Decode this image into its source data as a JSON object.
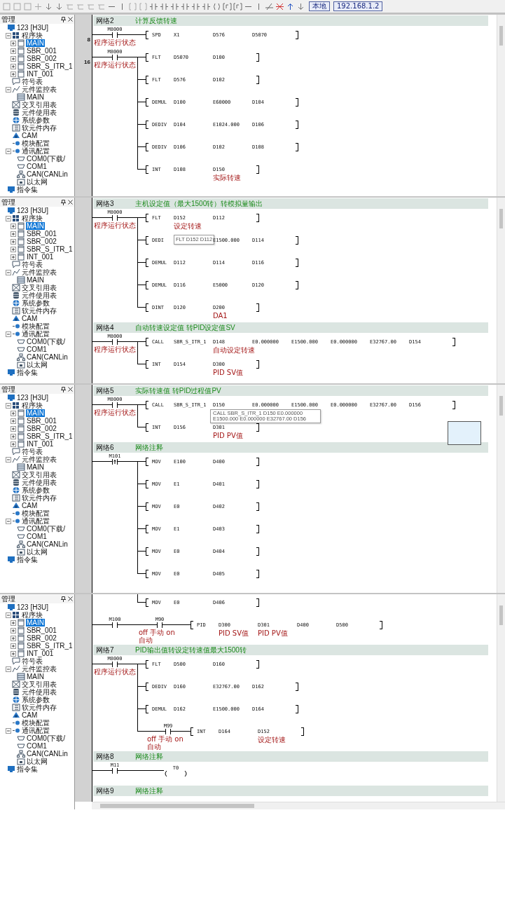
{
  "toolbar": {
    "buttons": [
      {
        "label": "本地"
      },
      {
        "label": "192.168.1.2"
      }
    ]
  },
  "panels": [
    {
      "sidebar": {
        "title": "管理",
        "tree": [
          {
            "label": "123 [H3U]",
            "kind": "plc",
            "selected": false,
            "children": [
              {
                "label": "程序块",
                "kind": "blocks",
                "selected": false,
                "expanded": true,
                "children": [
                  {
                    "label": "MAIN",
                    "kind": "program",
                    "selected": true,
                    "expanded": false
                  },
                  {
                    "label": "SBR_001",
                    "kind": "program",
                    "selected": false,
                    "expanded": false
                  },
                  {
                    "label": "SBR_002",
                    "kind": "program",
                    "selected": false,
                    "expanded": false
                  },
                  {
                    "label": "SBR_S_ITR_1",
                    "kind": "program",
                    "selected": false,
                    "expanded": false
                  },
                  {
                    "label": "INT_001",
                    "kind": "program",
                    "selected": false,
                    "expanded": false
                  }
                ]
              },
              {
                "label": "符号表",
                "kind": "symbols",
                "selected": false
              },
              {
                "label": "元件监控表",
                "kind": "monitor",
                "selected": false,
                "expanded": true,
                "children": [
                  {
                    "label": "MAIN",
                    "kind": "table",
                    "selected": false
                  }
                ]
              },
              {
                "label": "交叉引用表",
                "kind": "crossref",
                "selected": false
              },
              {
                "label": "元件使用表",
                "kind": "usage",
                "selected": false
              },
              {
                "label": "系统参数",
                "kind": "params",
                "selected": false
              },
              {
                "label": "软元件内存",
                "kind": "memory",
                "selected": false
              },
              {
                "label": "CAM",
                "kind": "cam",
                "selected": false
              },
              {
                "label": "模块配置",
                "kind": "module",
                "selected": false
              },
              {
                "label": "通讯配置",
                "kind": "module",
                "selected": false,
                "expanded": true,
                "children": [
                  {
                    "label": "COM0(下载/",
                    "kind": "port",
                    "selected": false
                  },
                  {
                    "label": "COM1",
                    "kind": "port",
                    "selected": false
                  },
                  {
                    "label": "CAN(CANLin",
                    "kind": "network",
                    "selected": false
                  },
                  {
                    "label": "以太网",
                    "kind": "ethernet",
                    "selected": false
                  }
                ]
              }
            ]
          },
          {
            "label": "指令集",
            "kind": "plc",
            "selected": false
          }
        ]
      },
      "ladder": {
        "rows": [
          {
            "kind": "network",
            "label": "网络2",
            "comment": "计算反馈转速"
          },
          {
            "kind": "rung",
            "step": "8",
            "contacts": [
              {
                "kind": "normally_open",
                "device": "M8000",
                "comment": "程序运行状态"
              }
            ],
            "branches": [
              {
                "kind": "instruction",
                "instr": "SPD",
                "operands": [
                  {
                    "text": "X1"
                  },
                  {
                    "text": "D576"
                  },
                  {
                    "text": "D5070"
                  }
                ]
              }
            ]
          },
          {
            "kind": "rung",
            "step": "16",
            "contacts": [
              {
                "kind": "normally_open",
                "device": "M8000",
                "comment": "程序运行状态"
              }
            ],
            "branches": [
              {
                "kind": "instruction",
                "instr": "FLT",
                "operands": [
                  {
                    "text": "D5070"
                  },
                  {
                    "text": "D100"
                  }
                ]
              },
              {
                "kind": "instruction",
                "instr": "FLT",
                "operands": [
                  {
                    "text": "D576"
                  },
                  {
                    "text": "D102"
                  }
                ]
              },
              {
                "kind": "instruction",
                "instr": "DEMUL",
                "operands": [
                  {
                    "text": "D100"
                  },
                  {
                    "text": "E60000"
                  },
                  {
                    "text": "D104"
                  }
                ]
              },
              {
                "kind": "instruction",
                "instr": "DEDIV",
                "operands": [
                  {
                    "text": "D104"
                  },
                  {
                    "text": "E1024.000"
                  },
                  {
                    "text": "D106"
                  }
                ]
              },
              {
                "kind": "instruction",
                "instr": "DEDIV",
                "operands": [
                  {
                    "text": "D106"
                  },
                  {
                    "text": "D102"
                  },
                  {
                    "text": "D108"
                  }
                ]
              },
              {
                "kind": "instruction",
                "instr": "INT",
                "operands": [
                  {
                    "text": "D108"
                  },
                  {
                    "text": "D150",
                    "comment": "实际转速"
                  }
                ]
              }
            ]
          }
        ]
      }
    },
    {
      "sidebar": {
        "title": "管理",
        "tree": [
          {
            "label": "123 [H3U]",
            "kind": "plc",
            "selected": false,
            "children": [
              {
                "label": "程序块",
                "kind": "blocks",
                "selected": false,
                "expanded": true,
                "children": [
                  {
                    "label": "MAIN",
                    "kind": "program",
                    "selected": true,
                    "expanded": false
                  },
                  {
                    "label": "SBR_001",
                    "kind": "program",
                    "selected": false,
                    "expanded": false
                  },
                  {
                    "label": "SBR_002",
                    "kind": "program",
                    "selected": false,
                    "expanded": false
                  },
                  {
                    "label": "SBR_S_ITR_1",
                    "kind": "program",
                    "selected": false,
                    "expanded": false
                  },
                  {
                    "label": "INT_001",
                    "kind": "program",
                    "selected": false,
                    "expanded": false
                  }
                ]
              },
              {
                "label": "符号表",
                "kind": "symbols",
                "selected": false
              },
              {
                "label": "元件监控表",
                "kind": "monitor",
                "selected": false,
                "expanded": true,
                "children": [
                  {
                    "label": "MAIN",
                    "kind": "table",
                    "selected": false
                  }
                ]
              },
              {
                "label": "交叉引用表",
                "kind": "crossref",
                "selected": false
              },
              {
                "label": "元件使用表",
                "kind": "usage",
                "selected": false
              },
              {
                "label": "系统参数",
                "kind": "params",
                "selected": false
              },
              {
                "label": "软元件内存",
                "kind": "memory",
                "selected": false
              },
              {
                "label": "CAM",
                "kind": "cam",
                "selected": false
              },
              {
                "label": "模块配置",
                "kind": "module",
                "selected": false
              },
              {
                "label": "通讯配置",
                "kind": "module",
                "selected": false,
                "expanded": true,
                "children": [
                  {
                    "label": "COM0(下载/",
                    "kind": "port",
                    "selected": false
                  },
                  {
                    "label": "COM1",
                    "kind": "port",
                    "selected": false
                  },
                  {
                    "label": "CAN(CANLin",
                    "kind": "network",
                    "selected": false
                  },
                  {
                    "label": "以太网",
                    "kind": "ethernet",
                    "selected": false
                  }
                ]
              }
            ]
          },
          {
            "label": "指令集",
            "kind": "plc",
            "selected": false
          }
        ]
      },
      "ladder": {
        "rows": [
          {
            "kind": "network",
            "label": "网络3",
            "comment": "主机设定值（最大1500转）转模拟量输出"
          },
          {
            "kind": "rung",
            "contacts": [
              {
                "kind": "normally_open",
                "device": "M8000",
                "comment": "程序运行状态"
              }
            ],
            "branches": [
              {
                "kind": "instruction",
                "instr": "FLT",
                "operands": [
                  {
                    "text": "D152",
                    "comment": "设定转速"
                  },
                  {
                    "text": "D112"
                  }
                ]
              },
              {
                "kind": "instruction",
                "instr": "DEDI",
                "operands": [
                  {
                    "tooltip": "FLT D152 D112"
                  },
                  {
                    "text": "E1500.000"
                  },
                  {
                    "text": "D114"
                  }
                ]
              },
              {
                "kind": "instruction",
                "instr": "DEMUL",
                "operands": [
                  {
                    "text": "D112"
                  },
                  {
                    "text": "D114"
                  },
                  {
                    "text": "D116"
                  }
                ]
              },
              {
                "kind": "instruction",
                "instr": "DEMUL",
                "operands": [
                  {
                    "text": "D116"
                  },
                  {
                    "text": "E5000"
                  },
                  {
                    "text": "D120"
                  }
                ]
              },
              {
                "kind": "instruction",
                "instr": "DINT",
                "operands": [
                  {
                    "text": "D120"
                  },
                  {
                    "text": "D200",
                    "comment": "DA1"
                  }
                ]
              }
            ]
          },
          {
            "kind": "network",
            "label": "网络4",
            "comment": "自动转速设定值 转PID设定值SV"
          },
          {
            "kind": "rung",
            "contacts": [
              {
                "kind": "normally_open",
                "device": "M8000",
                "comment": "程序运行状态"
              }
            ],
            "branches": [
              {
                "kind": "instruction",
                "instr": "CALL",
                "operands": [
                  {
                    "text": "SBR_S_ITR_1"
                  },
                  {
                    "text": "D148",
                    "comment": "自动设定转速"
                  },
                  {
                    "text": "E0.000000"
                  },
                  {
                    "text": "E1500.000"
                  },
                  {
                    "text": "E0.000000"
                  },
                  {
                    "text": "E32767.00"
                  },
                  {
                    "text": "D154"
                  }
                ]
              },
              {
                "kind": "instruction",
                "instr": "INT",
                "operands": [
                  {
                    "text": "D154"
                  },
                  {
                    "text": "D300",
                    "comment": "PID SV值"
                  }
                ]
              }
            ]
          }
        ]
      }
    },
    {
      "sidebar": {
        "title": "管理",
        "tree": [
          {
            "label": "123 [H3U]",
            "kind": "plc",
            "selected": false,
            "children": [
              {
                "label": "程序块",
                "kind": "blocks",
                "selected": false,
                "expanded": true,
                "children": [
                  {
                    "label": "MAIN",
                    "kind": "program",
                    "selected": true,
                    "expanded": false
                  },
                  {
                    "label": "SBR_001",
                    "kind": "program",
                    "selected": false,
                    "expanded": false
                  },
                  {
                    "label": "SBR_002",
                    "kind": "program",
                    "selected": false,
                    "expanded": false
                  },
                  {
                    "label": "SBR_S_ITR_1",
                    "kind": "program",
                    "selected": false,
                    "expanded": false
                  },
                  {
                    "label": "INT_001",
                    "kind": "program",
                    "selected": false,
                    "expanded": false
                  }
                ]
              },
              {
                "label": "符号表",
                "kind": "symbols",
                "selected": false
              },
              {
                "label": "元件监控表",
                "kind": "monitor",
                "selected": false,
                "expanded": true,
                "children": [
                  {
                    "label": "MAIN",
                    "kind": "table",
                    "selected": false
                  }
                ]
              },
              {
                "label": "交叉引用表",
                "kind": "crossref",
                "selected": false
              },
              {
                "label": "元件使用表",
                "kind": "usage",
                "selected": false
              },
              {
                "label": "系统参数",
                "kind": "params",
                "selected": false
              },
              {
                "label": "软元件内存",
                "kind": "memory",
                "selected": false
              },
              {
                "label": "CAM",
                "kind": "cam",
                "selected": false
              },
              {
                "label": "模块配置",
                "kind": "module",
                "selected": false
              },
              {
                "label": "通讯配置",
                "kind": "module",
                "selected": false,
                "expanded": true,
                "children": [
                  {
                    "label": "COM0(下载/",
                    "kind": "port",
                    "selected": false
                  },
                  {
                    "label": "COM1",
                    "kind": "port",
                    "selected": false
                  },
                  {
                    "label": "CAN(CANLin",
                    "kind": "network",
                    "selected": false
                  },
                  {
                    "label": "以太网",
                    "kind": "ethernet",
                    "selected": false
                  }
                ]
              }
            ]
          },
          {
            "label": "指令集",
            "kind": "plc",
            "selected": false
          }
        ]
      },
      "ladder": {
        "blank_box": true,
        "rows": [
          {
            "kind": "network",
            "label": "网络5",
            "comment": "实际转速值 转PID过程值PV"
          },
          {
            "kind": "rung",
            "contacts": [
              {
                "kind": "normally_open",
                "device": "M8000",
                "comment": "程序运行状态"
              }
            ],
            "branches": [
              {
                "kind": "instruction",
                "instr": "CALL",
                "operands": [
                  {
                    "text": "SBR_S_ITR_1"
                  },
                  {
                    "text": "D150",
                    "tooltip": "CALL SBR_S_ITR_1 D150 E0.000000 E1500.000 E0.000000 E32767.00 D156"
                  },
                  {
                    "text": "E0.000000"
                  },
                  {
                    "text": "E1500.000"
                  },
                  {
                    "text": "E0.000000"
                  },
                  {
                    "text": "E32767.00"
                  },
                  {
                    "text": "D156"
                  }
                ]
              },
              {
                "kind": "instruction",
                "instr": "INT",
                "operands": [
                  {
                    "text": "D156"
                  },
                  {
                    "text": "D301",
                    "comment": "PID PV值"
                  }
                ]
              }
            ]
          },
          {
            "kind": "network",
            "label": "网络6",
            "comment": "网络注释"
          },
          {
            "kind": "rung",
            "contacts": [
              {
                "kind": "rising_edge",
                "device": "M101"
              }
            ],
            "branches": [
              {
                "kind": "instruction",
                "instr": "MOV",
                "operands": [
                  {
                    "text": "E100"
                  },
                  {
                    "text": "D400"
                  }
                ]
              },
              {
                "kind": "instruction",
                "instr": "MOV",
                "operands": [
                  {
                    "text": "E1"
                  },
                  {
                    "text": "D401"
                  }
                ]
              },
              {
                "kind": "instruction",
                "instr": "MOV",
                "operands": [
                  {
                    "text": "E0"
                  },
                  {
                    "text": "D402"
                  }
                ]
              },
              {
                "kind": "instruction",
                "instr": "MOV",
                "operands": [
                  {
                    "text": "E1"
                  },
                  {
                    "text": "D403"
                  }
                ]
              },
              {
                "kind": "instruction",
                "instr": "MOV",
                "operands": [
                  {
                    "text": "E0"
                  },
                  {
                    "text": "D404"
                  }
                ]
              },
              {
                "kind": "instruction",
                "instr": "MOV",
                "operands": [
                  {
                    "text": "E0"
                  },
                  {
                    "text": "D405"
                  }
                ]
              }
            ]
          }
        ]
      }
    },
    {
      "sidebar": {
        "title": "管理",
        "tree": [
          {
            "label": "123 [H3U]",
            "kind": "plc",
            "selected": false,
            "children": [
              {
                "label": "程序块",
                "kind": "blocks",
                "selected": false,
                "expanded": true,
                "children": [
                  {
                    "label": "MAIN",
                    "kind": "program",
                    "selected": true,
                    "expanded": false
                  },
                  {
                    "label": "SBR_001",
                    "kind": "program",
                    "selected": false,
                    "expanded": false
                  },
                  {
                    "label": "SBR_002",
                    "kind": "program",
                    "selected": false,
                    "expanded": false
                  },
                  {
                    "label": "SBR_S_ITR_1",
                    "kind": "program",
                    "selected": false,
                    "expanded": false
                  },
                  {
                    "label": "INT_001",
                    "kind": "program",
                    "selected": false,
                    "expanded": false
                  }
                ]
              },
              {
                "label": "符号表",
                "kind": "symbols",
                "selected": false
              },
              {
                "label": "元件监控表",
                "kind": "monitor",
                "selected": false,
                "expanded": true,
                "children": [
                  {
                    "label": "MAIN",
                    "kind": "table",
                    "selected": false
                  }
                ]
              },
              {
                "label": "交叉引用表",
                "kind": "crossref",
                "selected": false
              },
              {
                "label": "元件使用表",
                "kind": "usage",
                "selected": false
              },
              {
                "label": "系统参数",
                "kind": "params",
                "selected": false
              },
              {
                "label": "软元件内存",
                "kind": "memory",
                "selected": false
              },
              {
                "label": "CAM",
                "kind": "cam",
                "selected": false
              },
              {
                "label": "模块配置",
                "kind": "module",
                "selected": false
              },
              {
                "label": "通讯配置",
                "kind": "module",
                "selected": false,
                "expanded": true,
                "children": [
                  {
                    "label": "COM0(下载/",
                    "kind": "port",
                    "selected": false
                  },
                  {
                    "label": "COM1",
                    "kind": "port",
                    "selected": false
                  },
                  {
                    "label": "CAN(CANLin",
                    "kind": "network",
                    "selected": false
                  },
                  {
                    "label": "以太网",
                    "kind": "ethernet",
                    "selected": false
                  }
                ]
              }
            ]
          },
          {
            "label": "指令集",
            "kind": "plc",
            "selected": false
          }
        ]
      },
      "ladder": {
        "horizontal_scrollbar": true,
        "rows": [
          {
            "kind": "rung",
            "continued": true,
            "branches": [
              {
                "kind": "instruction",
                "instr": "MOV",
                "operands": [
                  {
                    "text": "E0"
                  },
                  {
                    "text": "D406"
                  }
                ]
              }
            ]
          },
          {
            "kind": "rung",
            "contacts": [
              {
                "kind": "normally_open",
                "device": "M100"
              },
              {
                "kind": "normally_open",
                "device": "M90",
                "comment": "off 手动 on 自动"
              }
            ],
            "branches": [
              {
                "kind": "instruction",
                "instr": "PID",
                "operands": [
                  {
                    "text": "D300",
                    "comment": "PID SV值"
                  },
                  {
                    "text": "D301",
                    "comment": "PID PV值"
                  },
                  {
                    "text": "D400"
                  },
                  {
                    "text": "D500"
                  }
                ]
              }
            ]
          },
          {
            "kind": "network",
            "label": "网络7",
            "comment": "PID输出值转设定转速值最大1500转"
          },
          {
            "kind": "rung",
            "contacts": [
              {
                "kind": "normally_open",
                "device": "M8000",
                "comment": "程序运行状态"
              }
            ],
            "branches": [
              {
                "kind": "instruction",
                "instr": "FLT",
                "operands": [
                  {
                    "text": "D500"
                  },
                  {
                    "text": "D160"
                  }
                ]
              },
              {
                "kind": "instruction",
                "instr": "DEDIV",
                "operands": [
                  {
                    "text": "D160"
                  },
                  {
                    "text": "E32767.00"
                  },
                  {
                    "text": "D162"
                  }
                ]
              },
              {
                "kind": "instruction",
                "instr": "DEMUL",
                "operands": [
                  {
                    "text": "D162"
                  },
                  {
                    "text": "E1500.000"
                  },
                  {
                    "text": "D164"
                  }
                ]
              },
              {
                "kind": "instruction",
                "instr": "INT",
                "contact": {
                  "kind": "normally_open",
                  "device": "M99",
                  "comment": "off 手动 on 自动"
                },
                "operands": [
                  {
                    "text": "D164"
                  },
                  {
                    "text": "D152",
                    "comment": "设定转速"
                  }
                ]
              }
            ]
          },
          {
            "kind": "network",
            "label": "网络8",
            "comment": "网络注释"
          },
          {
            "kind": "rung",
            "contacts": [
              {
                "kind": "normally_open",
                "device": "M11"
              }
            ],
            "branches": [
              {
                "kind": "coil",
                "device": "T0"
              }
            ]
          },
          {
            "kind": "network",
            "label": "网络9",
            "comment": "网络注释"
          }
        ]
      }
    }
  ]
}
